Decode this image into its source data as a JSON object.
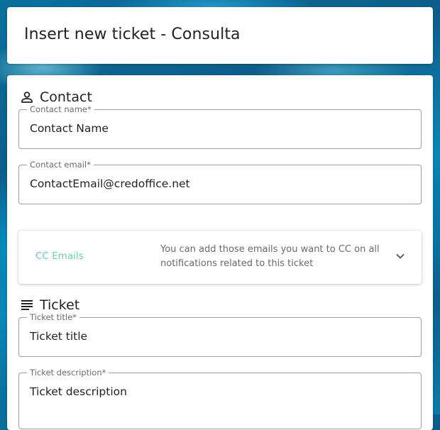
{
  "header": {
    "title": "Insert new ticket - Consulta"
  },
  "contact": {
    "section_title": "Contact",
    "section_icon": "person-icon",
    "name_field": {
      "label": "Contact name*",
      "value": "Contact Name"
    },
    "email_field": {
      "label": "Contact email*",
      "value": "ContactEmail@credoffice.net"
    }
  },
  "cc": {
    "label": "CC Emails",
    "description": "You can add those emails you want to CC on all notifications related to this ticket",
    "icon": "chevron-down-icon",
    "accent_color": "#6ccfae"
  },
  "ticket": {
    "section_title": "Ticket",
    "section_icon": "lines-icon",
    "title_field": {
      "label": "Ticket title*",
      "value": "Ticket title"
    },
    "description_field": {
      "label": "Ticket description*",
      "value": "Ticket description"
    }
  }
}
